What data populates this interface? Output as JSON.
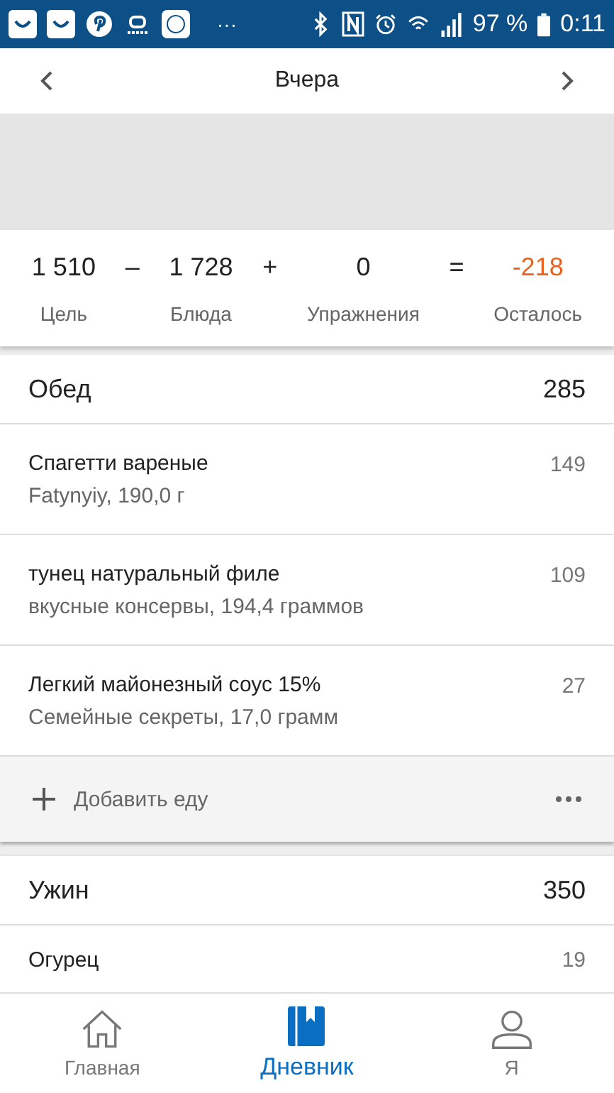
{
  "status_bar": {
    "more": "···",
    "battery": "97 %",
    "time": "0:11"
  },
  "header": {
    "title": "Вчера"
  },
  "summary": [
    {
      "kind": "value",
      "value": "1 510",
      "label": "Цель"
    },
    {
      "kind": "op",
      "value": "–"
    },
    {
      "kind": "value",
      "value": "1 728",
      "label": "Блюда"
    },
    {
      "kind": "op",
      "value": "+"
    },
    {
      "kind": "value",
      "value": "0",
      "label": "Упражнения"
    },
    {
      "kind": "op",
      "value": "="
    },
    {
      "kind": "remaining",
      "value": "-218",
      "label": "Осталось"
    }
  ],
  "meals": [
    {
      "name": "Обед",
      "calories": "285",
      "items": [
        {
          "name": "Спагетти вареные",
          "detail": "Fatynyiy, 190,0 г",
          "calories": "149"
        },
        {
          "name": "тунец натуральный филе",
          "detail": "вкусные консервы, 194,4 граммов",
          "calories": "109"
        },
        {
          "name": "Легкий майонезный соус 15%",
          "detail": "Семейные секреты, 17,0 грамм",
          "calories": "27"
        }
      ],
      "add_label": "Добавить еду"
    },
    {
      "name": "Ужин",
      "calories": "350",
      "items": [
        {
          "name": "Огурец",
          "calories": "19"
        }
      ]
    }
  ],
  "nav": [
    {
      "kind": "home",
      "label": "Главная",
      "selected": false
    },
    {
      "kind": "diary",
      "label": "Дневник",
      "selected": true
    },
    {
      "kind": "me",
      "label": "Я",
      "selected": false
    }
  ]
}
